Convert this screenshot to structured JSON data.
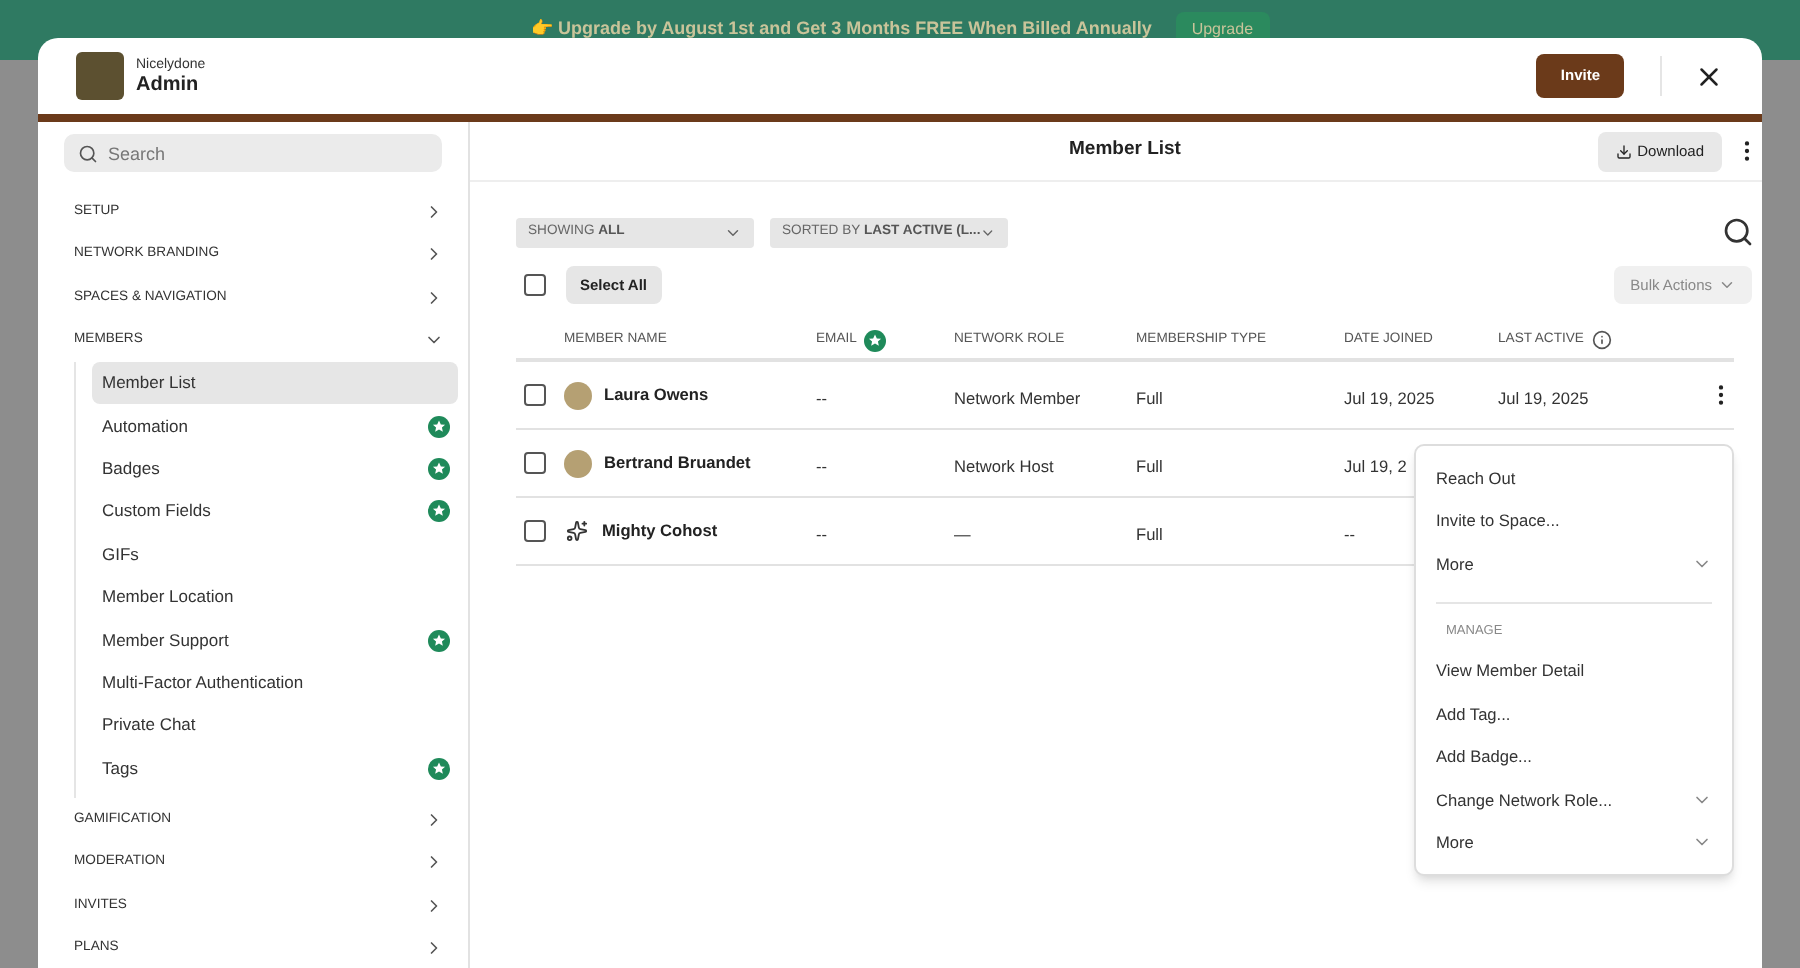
{
  "banner": {
    "text": "👉 Upgrade by August 1st and Get 3 Months FREE When Billed Annually",
    "button": "Upgrade"
  },
  "modal": {
    "network": "Nicelydone",
    "title": "Admin",
    "invite": "Invite"
  },
  "sidebar": {
    "search_placeholder": "Search",
    "sections": [
      {
        "label": "SETUP",
        "expanded": false
      },
      {
        "label": "NETWORK BRANDING",
        "expanded": false
      },
      {
        "label": "SPACES & NAVIGATION",
        "expanded": false
      },
      {
        "label": "MEMBERS",
        "expanded": true,
        "children": [
          {
            "label": "Member List",
            "selected": true,
            "starred": false
          },
          {
            "label": "Automation",
            "selected": false,
            "starred": true
          },
          {
            "label": "Badges",
            "selected": false,
            "starred": true
          },
          {
            "label": "Custom Fields",
            "selected": false,
            "starred": true
          },
          {
            "label": "GIFs",
            "selected": false,
            "starred": false
          },
          {
            "label": "Member Location",
            "selected": false,
            "starred": false
          },
          {
            "label": "Member Support",
            "selected": false,
            "starred": true
          },
          {
            "label": "Multi-Factor Authentication",
            "selected": false,
            "starred": false
          },
          {
            "label": "Private Chat",
            "selected": false,
            "starred": false
          },
          {
            "label": "Tags",
            "selected": false,
            "starred": true
          }
        ]
      },
      {
        "label": "GAMIFICATION",
        "expanded": false
      },
      {
        "label": "MODERATION",
        "expanded": false
      },
      {
        "label": "INVITES",
        "expanded": false
      },
      {
        "label": "PLANS",
        "expanded": false
      }
    ]
  },
  "main": {
    "title": "Member List",
    "download": "Download",
    "filters": [
      {
        "prefix": "SHOWING",
        "value": "ALL"
      },
      {
        "prefix": "SORTED BY",
        "value": "LAST ACTIVE (L..."
      }
    ],
    "select_all_checked": false,
    "select_all": "Select All",
    "bulk_actions": "Bulk Actions",
    "table": {
      "columns": [
        {
          "label": "MEMBER NAME",
          "kind": "plain"
        },
        {
          "label": "EMAIL",
          "kind": "star"
        },
        {
          "label": "NETWORK ROLE",
          "kind": "plain"
        },
        {
          "label": "MEMBERSHIP TYPE",
          "kind": "plain"
        },
        {
          "label": "DATE JOINED",
          "kind": "plain"
        },
        {
          "label": "LAST ACTIVE",
          "kind": "info"
        }
      ],
      "rows": [
        {
          "kind": "photo",
          "checked": false,
          "name": "Laura Owens",
          "email": "--",
          "role": "Network Member",
          "type": "Full",
          "joined": "Jul 19, 2025",
          "last_active": "Jul 19, 2025",
          "menu": true
        },
        {
          "kind": "photo",
          "checked": false,
          "name": "Bertrand Bruandet",
          "email": "--",
          "role": "Network Host",
          "type": "Full",
          "joined": "Jul 19, 2",
          "menu": false
        },
        {
          "kind": "bot",
          "checked": false,
          "name": "Mighty Cohost",
          "email": "--",
          "role": "—",
          "type": "Full",
          "joined": "--",
          "menu": false
        }
      ]
    },
    "context_menu": {
      "groups": [
        {
          "items": [
            {
              "label": "Reach Out",
              "submenu": false
            },
            {
              "label": "Invite to Space...",
              "submenu": false
            },
            {
              "label": "More",
              "submenu": true
            }
          ]
        },
        {
          "heading": "MANAGE",
          "items": [
            {
              "label": "View Member Detail",
              "submenu": false
            },
            {
              "label": "Add Tag...",
              "submenu": false
            },
            {
              "label": "Add Badge...",
              "submenu": false
            },
            {
              "label": "Change Network Role...",
              "submenu": true
            },
            {
              "label": "More",
              "submenu": true
            }
          ]
        }
      ]
    }
  }
}
